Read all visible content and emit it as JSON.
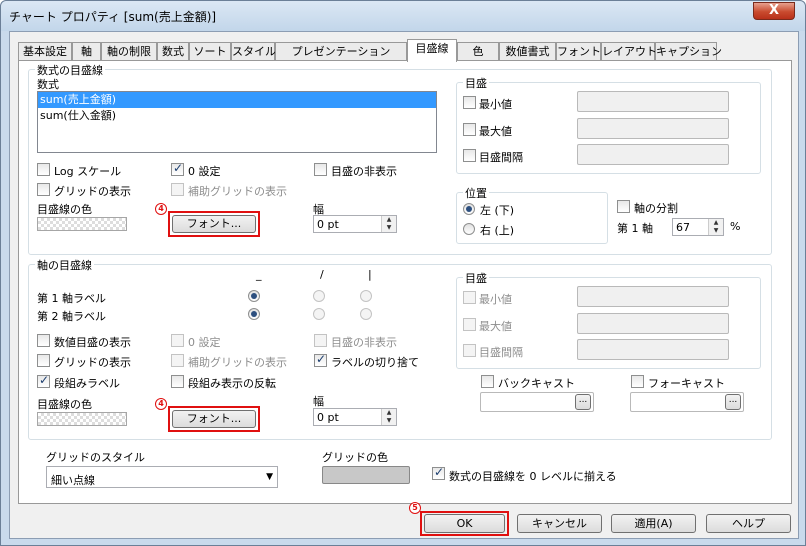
{
  "window": {
    "title": "チャート プロパティ [sum(売上金額)]",
    "close_glyph": "X"
  },
  "tabs": [
    {
      "label": "基本設定"
    },
    {
      "label": "軸"
    },
    {
      "label": "軸の制限"
    },
    {
      "label": "数式"
    },
    {
      "label": "ソート"
    },
    {
      "label": "スタイル"
    },
    {
      "label": "プレゼンテーション"
    },
    {
      "label": "目盛線"
    },
    {
      "label": "色"
    },
    {
      "label": "数値書式"
    },
    {
      "label": "フォント"
    },
    {
      "label": "レイアウト"
    },
    {
      "label": "キャプション"
    }
  ],
  "active_tab": "目盛線",
  "expr_grid": {
    "title": "数式の目盛線",
    "list_label": "数式",
    "list_items": [
      "sum(売上金額)",
      "sum(仕入金額)"
    ],
    "selected": "sum(売上金額)",
    "log_scale": {
      "label": "Log スケール",
      "checked": false
    },
    "zero_setting": {
      "label": "0 設定",
      "checked": true
    },
    "hide_grid": {
      "label": "目盛の非表示",
      "checked": false
    },
    "show_grid": {
      "label": "グリッドの表示",
      "checked": false
    },
    "minor_grid": {
      "label": "補助グリッドの表示",
      "checked": false
    },
    "color_label": "目盛線の色",
    "font_button": "フォント...",
    "width_label": "幅",
    "width_value": "0 pt",
    "scale": {
      "title": "目盛",
      "min": {
        "label": "最小値",
        "checked": false,
        "value": ""
      },
      "max": {
        "label": "最大値",
        "checked": false,
        "value": ""
      },
      "interval": {
        "label": "目盛間隔",
        "checked": false,
        "value": ""
      }
    },
    "position": {
      "title": "位置",
      "left": "左 (下)",
      "right": "右 (上)",
      "selected": "left"
    },
    "split_axis": {
      "label": "軸の分割",
      "checked": false
    },
    "first_axis": {
      "label": "第 1 軸",
      "value": "67",
      "unit": "%"
    }
  },
  "dim_grid": {
    "title": "軸の目盛線",
    "col_headers": [
      "_",
      "/",
      "|"
    ],
    "rows": [
      {
        "label": "第 1 軸ラベル",
        "selected": 0
      },
      {
        "label": "第 2 軸ラベル",
        "selected": 0
      }
    ],
    "show_value_grid": {
      "label": "数値目盛の表示",
      "checked": false
    },
    "zero_setting": {
      "label": "0 設定",
      "checked": false
    },
    "hide_grid": {
      "label": "目盛の非表示",
      "checked": false
    },
    "show_grid": {
      "label": "グリッドの表示",
      "checked": false
    },
    "minor_grid": {
      "label": "補助グリッドの表示",
      "checked": false
    },
    "cut_labels": {
      "label": "ラベルの切り捨て",
      "checked": true
    },
    "staggered_labels": {
      "label": "段組みラベル",
      "checked": true
    },
    "reverse_stagger": {
      "label": "段組み表示の反転",
      "checked": false
    },
    "color_label": "目盛線の色",
    "font_button": "フォント...",
    "width_label": "幅",
    "width_value": "0 pt",
    "scale": {
      "title": "目盛",
      "min": {
        "label": "最小値",
        "checked": false,
        "value": ""
      },
      "max": {
        "label": "最大値",
        "checked": false,
        "value": ""
      },
      "interval": {
        "label": "目盛間隔",
        "checked": false,
        "value": ""
      }
    },
    "backcast": {
      "label": "バックキャスト",
      "checked": false,
      "value": "",
      "browse": "..."
    },
    "forecast": {
      "label": "フォーキャスト",
      "checked": false,
      "value": "",
      "browse": "..."
    }
  },
  "grid_style": {
    "label": "グリッドのスタイル",
    "value": "細い点線"
  },
  "grid_color": {
    "label": "グリッドの色"
  },
  "align_zero": {
    "label": "数式の目盛線を 0 レベルに揃える",
    "checked": true
  },
  "footer": {
    "ok": "OK",
    "cancel": "キャンセル",
    "apply": "適用(A)",
    "help": "ヘルプ"
  },
  "annotations": {
    "marker_4": "4",
    "marker_5": "5"
  }
}
